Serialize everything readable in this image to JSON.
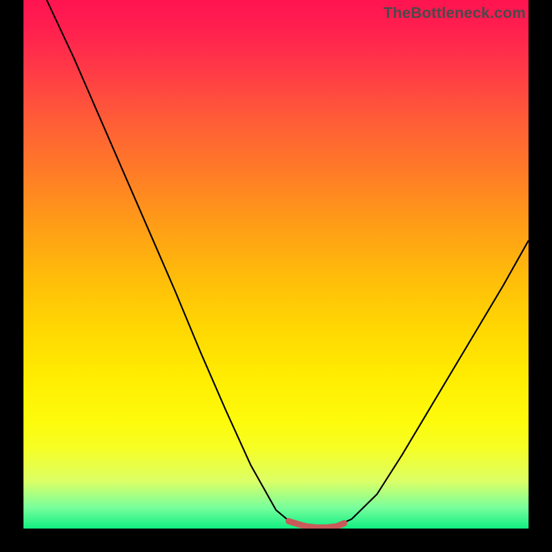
{
  "watermark": "TheBottleneck.com",
  "chart_data": {
    "type": "line",
    "title": "",
    "xlabel": "",
    "ylabel": "",
    "series": [
      {
        "name": "curve",
        "x": [
          0.046,
          0.1,
          0.15,
          0.2,
          0.25,
          0.3,
          0.35,
          0.4,
          0.45,
          0.5,
          0.525,
          0.55,
          0.58,
          0.6,
          0.62,
          0.65,
          0.7,
          0.75,
          0.8,
          0.85,
          0.9,
          0.95,
          1.0
        ],
        "y": [
          1.0,
          0.89,
          0.78,
          0.67,
          0.56,
          0.45,
          0.335,
          0.225,
          0.12,
          0.035,
          0.015,
          0.005,
          0.0,
          0.0,
          0.005,
          0.018,
          0.065,
          0.14,
          0.22,
          0.3,
          0.38,
          0.46,
          0.545
        ]
      },
      {
        "name": "bottom-marker",
        "x": [
          0.525,
          0.545,
          0.56,
          0.58,
          0.6,
          0.62,
          0.635
        ],
        "y": [
          0.014,
          0.008,
          0.004,
          0.002,
          0.002,
          0.004,
          0.01
        ]
      }
    ],
    "gradient_stops": [
      {
        "offset": 0.0,
        "color": "#ff1450"
      },
      {
        "offset": 0.5,
        "color": "#ffc508"
      },
      {
        "offset": 0.8,
        "color": "#fdfb0d"
      },
      {
        "offset": 1.0,
        "color": "#12ee82"
      }
    ]
  }
}
